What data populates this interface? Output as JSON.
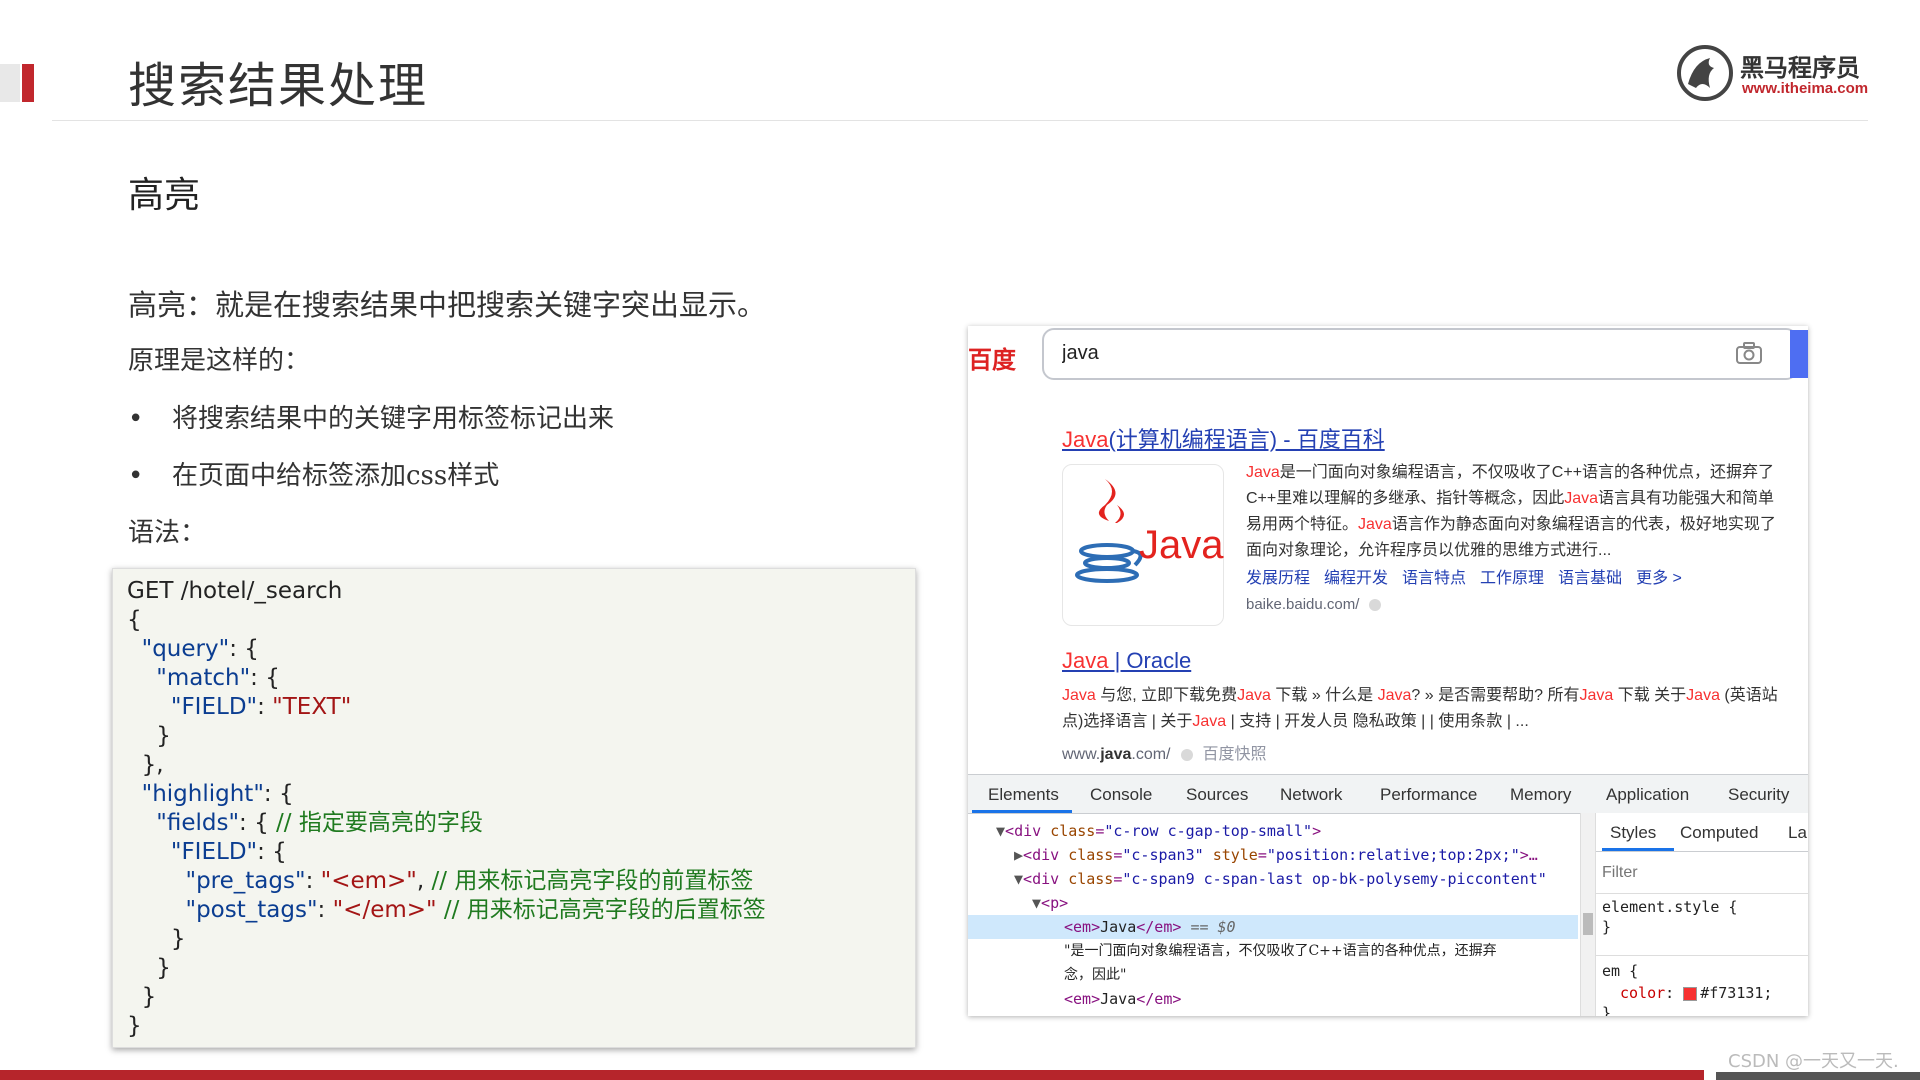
{
  "slide": {
    "title": "搜索结果处理",
    "section_heading": "高亮",
    "definition": "高亮：就是在搜索结果中把搜索关键字突出显示。",
    "principle_intro": "原理是这样的：",
    "bullets": [
      "将搜索结果中的关键字用标签标记出来",
      "在页面中给标签添加css样式"
    ],
    "syntax_label": "语法："
  },
  "logo": {
    "name_cn": "黑马程序员",
    "url": "www.itheima.com"
  },
  "code": {
    "lines": [
      "GET /hotel/_search",
      "{",
      "\"query\"",
      "\"match\"",
      "\"FIELD\"",
      "\"TEXT\"",
      "\"highlight\"",
      "\"fields\"",
      "// 指定要高亮的字段",
      "\"pre_tags\"",
      "\"<em>\"",
      "// 用来标记高亮字段的前置标签",
      "\"post_tags\"",
      "\"</em>\"",
      "// 用来标记高亮字段的后置标签"
    ]
  },
  "browser": {
    "logo": "百度",
    "search_value": "java",
    "result1": {
      "title_hl": "Java",
      "title_rest": "(计算机编程语言) - 百度百科",
      "logo_text": "Java",
      "abstract_parts": [
        "Java",
        "是一门面向对象编程语言，不仅吸收了C++语言的各种优点，还摒弃了C++里难以理解的多继承、指针等概念，因此",
        "Java",
        "语言具有功能强大和简单易用两个特征。",
        "Java",
        "语言作为静态面向对象编程语言的代表，极好地实现了面向对象理论，允许程序员以优雅的思维方式进行..."
      ],
      "links": [
        "发展历程",
        "编程开发",
        "语言特点",
        "工作原理",
        "语言基础",
        "更多 >"
      ],
      "url": "baike.baidu.com/"
    },
    "result2": {
      "title_hl": "Java",
      "title_rest": " | Oracle",
      "abstract_parts": [
        "Java",
        " 与您, 立即下载免费",
        "Java",
        " 下载 » 什么是 ",
        "Java",
        "? » 是否需要帮助? 所有",
        "Java",
        " 下载 关于",
        "Java",
        " (英语站点)选择语言 | 关于",
        "Java",
        " | 支持 | 开发人员 隐私政策 | | 使用条款 | ..."
      ],
      "url_pre": "www.",
      "url_bold": "java",
      "url_post": ".com/",
      "snapshot": "百度快照"
    }
  },
  "devtools": {
    "tabs": [
      "Elements",
      "Console",
      "Sources",
      "Network",
      "Performance",
      "Memory",
      "Application",
      "Security"
    ],
    "styles_tabs": [
      "Styles",
      "Computed",
      "La"
    ],
    "filter_placeholder": "Filter",
    "dom": {
      "l1_tag": "div",
      "l1_attr": "class",
      "l1_val": "\"c-row c-gap-top-small\"",
      "l2_tag": "div",
      "l2_attr": "class",
      "l2_val": "\"c-span3\"",
      "l2_attr2": "style",
      "l2_val2": "\"position:relative;top:2px;\"",
      "l3_tag": "div",
      "l3_attr": "class",
      "l3_val": "\"c-span9 c-span-last op-bk-polysemy-piccontent\"",
      "l4_tag": "p",
      "l5_text": "Java",
      "l5_suffix": "== $0",
      "l6_text": "\"是一门面向对象编程语言，不仅吸收了C++语言的各种优点，还摒弃",
      "l7_text": "念，因此\"",
      "l8_text": "Java"
    },
    "styles": {
      "rule1_selector": "element.style {",
      "rule2_selector": "em {",
      "prop": "color",
      "value": "#f73131;"
    }
  },
  "watermark": "CSDN @一天又一天.",
  "colors": {
    "accent": "#c1272d",
    "highlight": "#f73131",
    "link": "#2440b3",
    "baidu_blue": "#4e6ef2"
  }
}
